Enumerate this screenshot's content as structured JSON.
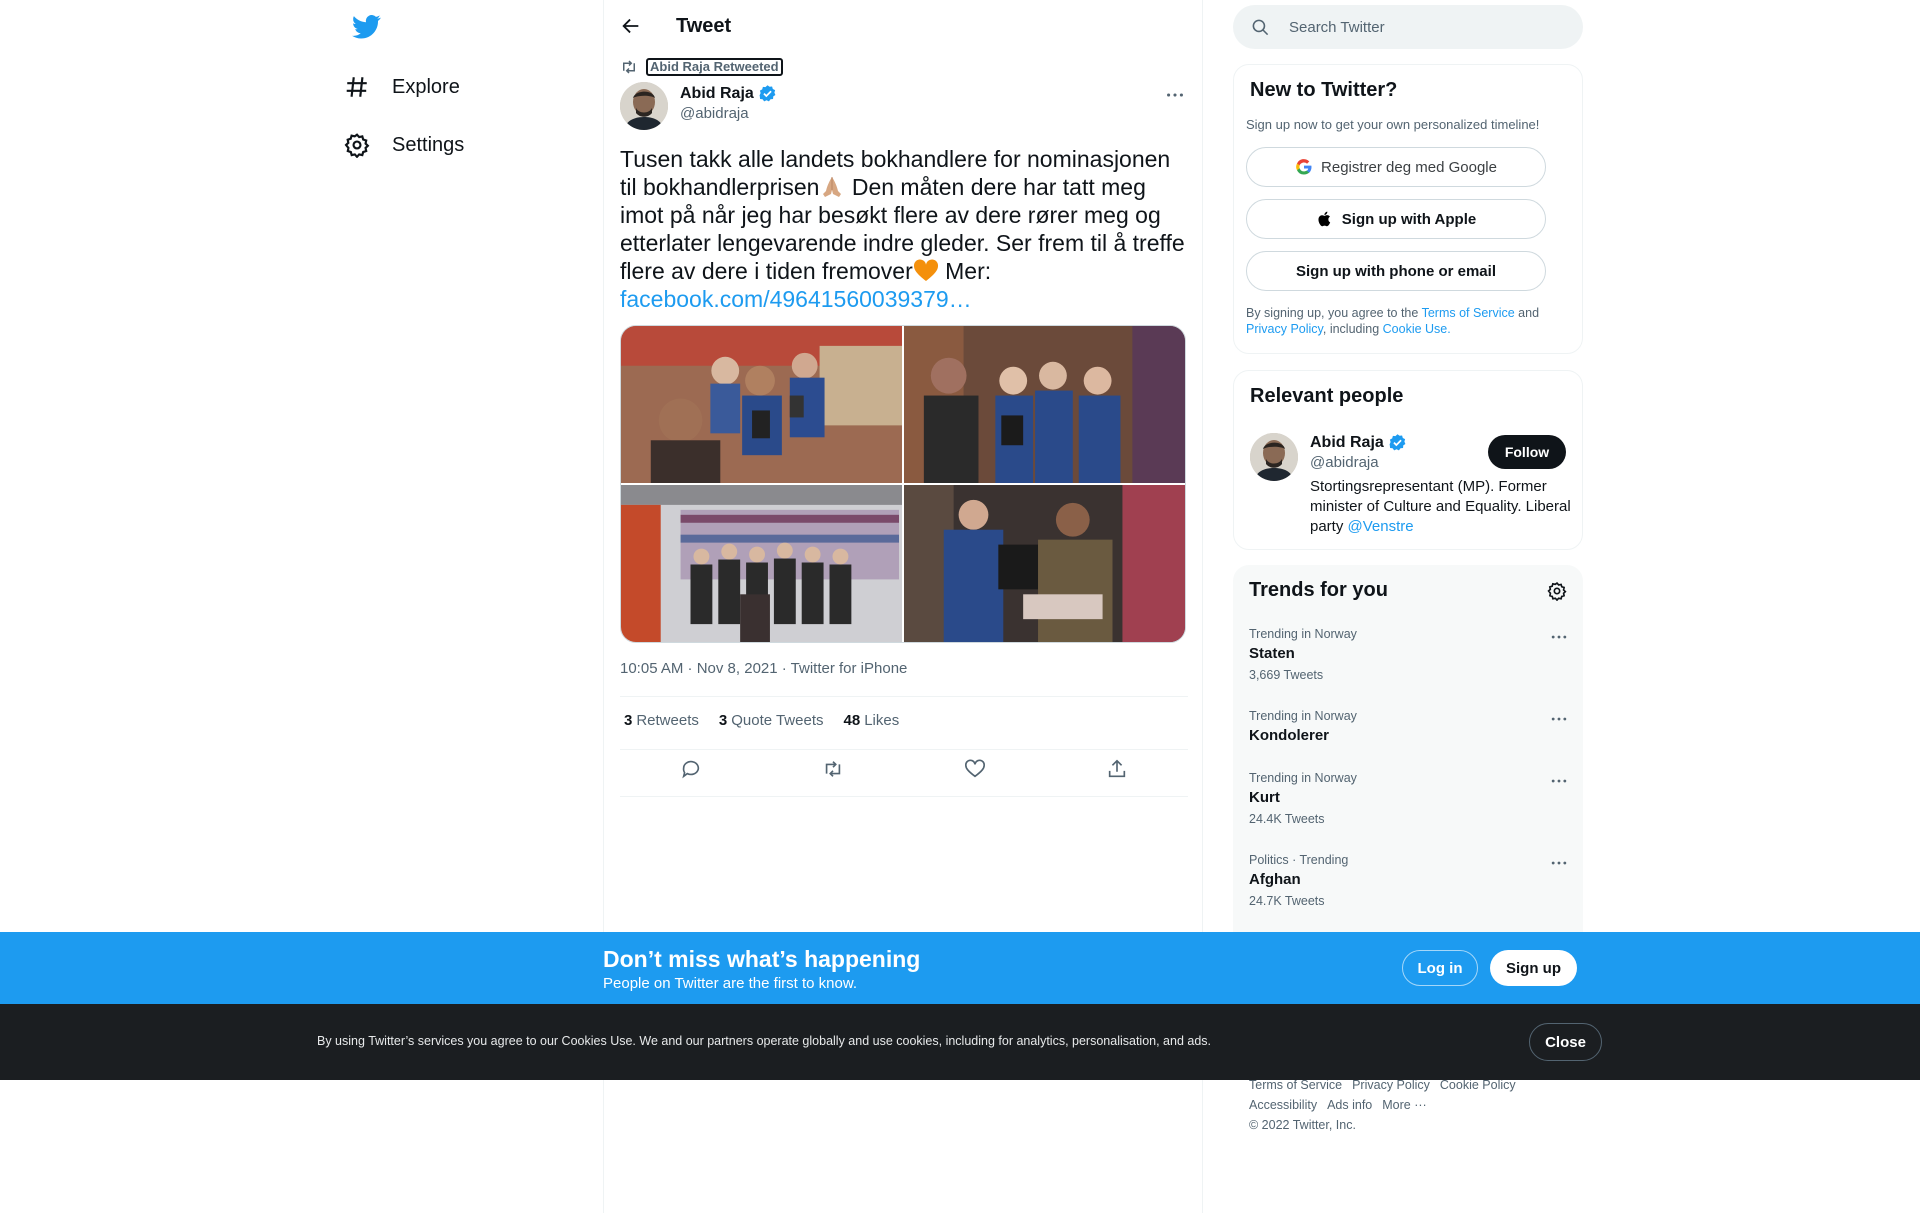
{
  "nav": {
    "logo_icon": "twitter-bird-icon",
    "explore_label": "Explore",
    "settings_label": "Settings"
  },
  "header": {
    "title": "Tweet",
    "back_icon": "arrow-left-icon"
  },
  "tweet": {
    "retweeted_by": "Abid Raja Retweeted",
    "author_name": "Abid Raja",
    "author_handle": "@abidraja",
    "text_part1": "Tusen takk alle landets bokhandlere for nominasjonen til bokhandlerprisen",
    "text_part2": " Den måten dere har tatt meg imot på når jeg har besøkt flere av dere rører meg og etterlater lengevarende indre gleder. Ser frem til å treffe flere av dere i tiden fremover",
    "text_part3": " Mer: ",
    "link": "facebook.com/49641560039379…",
    "timestamp": "10:05 AM · Nov 8, 2021 · Twitter for iPhone",
    "stats": {
      "retweets_count": "3",
      "retweets_label": "Retweets",
      "quotes_count": "3",
      "quotes_label": "Quote Tweets",
      "likes_count": "48",
      "likes_label": "Likes"
    }
  },
  "search": {
    "placeholder": "Search Twitter"
  },
  "signup": {
    "title": "New to Twitter?",
    "subtitle": "Sign up now to get your own personalized timeline!",
    "google_label": "Registrer deg med Google",
    "apple_label": "Sign up with Apple",
    "phone_label": "Sign up with phone or email",
    "terms_prefix": "By signing up, you agree to the ",
    "terms_link": "Terms of Service",
    "terms_and": " and ",
    "privacy_link": "Privacy Policy",
    "terms_including": ", including ",
    "cookie_link": "Cookie Use."
  },
  "people": {
    "title": "Relevant people",
    "name": "Abid Raja",
    "handle": "@abidraja",
    "follow_label": "Follow",
    "bio": "Stortingsrepresentant (MP). Former minister of Culture and Equality. Liberal party ",
    "bio_link": "@Venstre"
  },
  "trends": {
    "title": "Trends for you",
    "items": [
      {
        "meta": "Trending in Norway",
        "name": "Staten",
        "count": "3,669 Tweets"
      },
      {
        "meta": "Trending in Norway",
        "name": "Kondolerer",
        "count": ""
      },
      {
        "meta": "Trending in Norway",
        "name": "Kurt",
        "count": "24.4K Tweets"
      },
      {
        "meta": "Politics · Trending",
        "name": "Afghan",
        "count": "24.7K Tweets"
      }
    ]
  },
  "footer": {
    "tos": "Terms of Service",
    "privacy": "Privacy Policy",
    "cookie": "Cookie Policy",
    "accessibility": "Accessibility",
    "ads": "Ads info",
    "more": "More ···",
    "copyright": "© 2022 Twitter, Inc."
  },
  "banner": {
    "title": "Don’t miss what’s happening",
    "subtitle": "People on Twitter are the first to know.",
    "login_label": "Log in",
    "signup_label": "Sign up"
  },
  "cookie_bar": {
    "text": "By using Twitter’s services you agree to our Cookies Use. We and our partners operate globally and use cookies, including for analytics, personalisation, and ads.",
    "close_label": "Close"
  },
  "colors": {
    "accent": "#1d9bf0",
    "text": "#0f1419",
    "muted": "#536471",
    "cookie_bg": "#1b1e21"
  }
}
